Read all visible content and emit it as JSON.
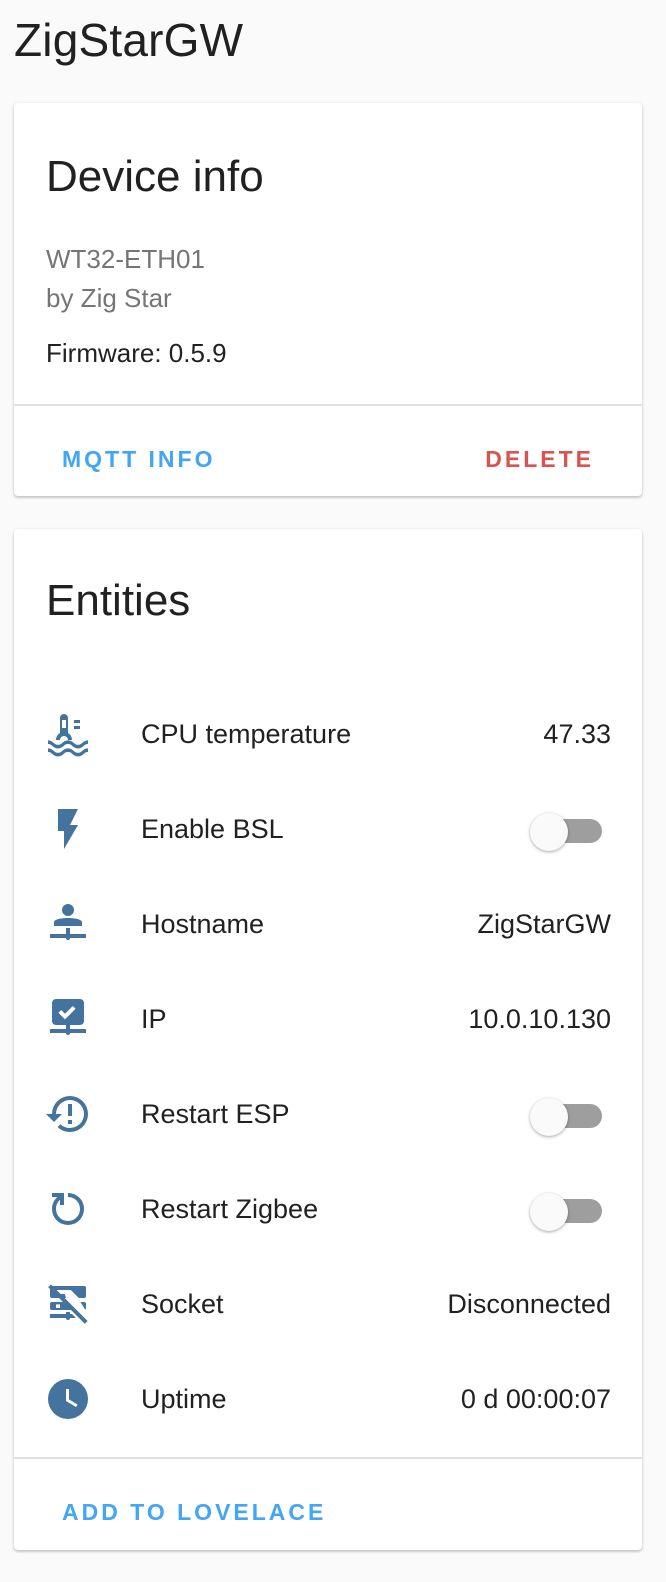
{
  "page": {
    "title": "ZigStarGW"
  },
  "device_info": {
    "heading": "Device info",
    "model": "WT32-ETH01",
    "manufacturer": "by Zig Star",
    "firmware": "Firmware: 0.5.9",
    "mqtt_info_label": "MQTT INFO",
    "delete_label": "DELETE"
  },
  "entities": {
    "heading": "Entities",
    "add_to_lovelace_label": "ADD TO LOVELACE",
    "items": [
      {
        "name": "CPU temperature",
        "state": "47.33",
        "icon": "thermometer-water-icon",
        "kind": "sensor"
      },
      {
        "name": "Enable BSL",
        "state": "off",
        "icon": "flash-icon",
        "kind": "switch"
      },
      {
        "name": "Hostname",
        "state": "ZigStarGW",
        "icon": "account-network-icon",
        "kind": "sensor"
      },
      {
        "name": "IP",
        "state": "10.0.10.130",
        "icon": "monitor-network-check-icon",
        "kind": "sensor"
      },
      {
        "name": "Restart ESP",
        "state": "off",
        "icon": "restart-alert-icon",
        "kind": "switch"
      },
      {
        "name": "Restart Zigbee",
        "state": "off",
        "icon": "restart-icon",
        "kind": "switch"
      },
      {
        "name": "Socket",
        "state": "Disconnected",
        "icon": "server-network-off-icon",
        "kind": "sensor"
      },
      {
        "name": "Uptime",
        "state": "0 d 00:00:07",
        "icon": "clock-icon",
        "kind": "sensor"
      }
    ]
  },
  "colors": {
    "accent": "#42a5f5",
    "danger": "#d9534f",
    "icon": "#44739e",
    "toggle_off_track": "#9e9e9e"
  }
}
